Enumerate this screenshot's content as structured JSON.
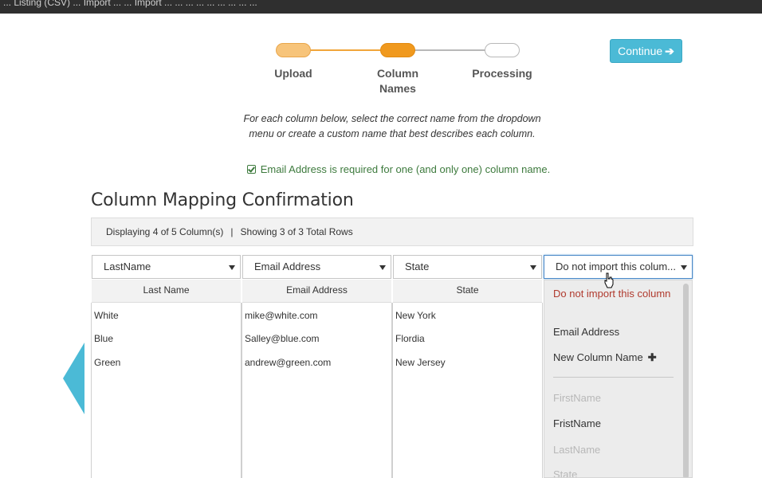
{
  "topbar": {
    "text": "... Listing (CSV) ... Import ... ... Import ... ... ... ... ... ... ... ... ..."
  },
  "stepper": {
    "steps": [
      {
        "label": "Upload",
        "state": "done"
      },
      {
        "label": "Column Names",
        "state": "current"
      },
      {
        "label": "Processing",
        "state": "pending"
      }
    ]
  },
  "continue_button": {
    "label": "Continue",
    "icon": "arrow-right-icon"
  },
  "instructions": "For each column below, select the correct name from the dropdown menu or create a custom name that best describes each column.",
  "required_note": {
    "icon": "checkbox-checked-icon",
    "text": "Email Address is required for one (and only one) column name."
  },
  "section_title": "Column Mapping Confirmation",
  "info_bar": {
    "displaying": "Displaying 4 of 5 Column(s)",
    "separator": "|",
    "showing": "Showing 3 of 3 Total Rows"
  },
  "columns": [
    {
      "selected": "LastName",
      "header": "Last Name",
      "cells": [
        "White",
        "Blue",
        "Green"
      ]
    },
    {
      "selected": "Email Address",
      "header": "Email Address",
      "cells": [
        "mike@white.com",
        "Salley@blue.com",
        "andrew@green.com"
      ]
    },
    {
      "selected": "State",
      "header": "State",
      "cells": [
        "New York",
        "Flordia",
        "New Jersey"
      ]
    },
    {
      "selected": "Do not import this colum...",
      "header": "",
      "cells": []
    }
  ],
  "dropdown": {
    "items": [
      {
        "label": "Do not import this column",
        "style": "warning"
      },
      {
        "label": "Email Address",
        "style": "normal"
      },
      {
        "label": "New Column Name",
        "style": "normal",
        "icon": "plus-icon"
      },
      {
        "label": "FirstName",
        "style": "disabled"
      },
      {
        "label": "FristName",
        "style": "normal"
      },
      {
        "label": "LastName",
        "style": "disabled"
      },
      {
        "label": "State",
        "style": "disabled"
      }
    ]
  },
  "colors": {
    "accent": "#4bbad6",
    "step_active": "#f0991e",
    "step_done": "#f7c47a",
    "success": "#3d7a3d",
    "warning": "#b03a2e"
  }
}
